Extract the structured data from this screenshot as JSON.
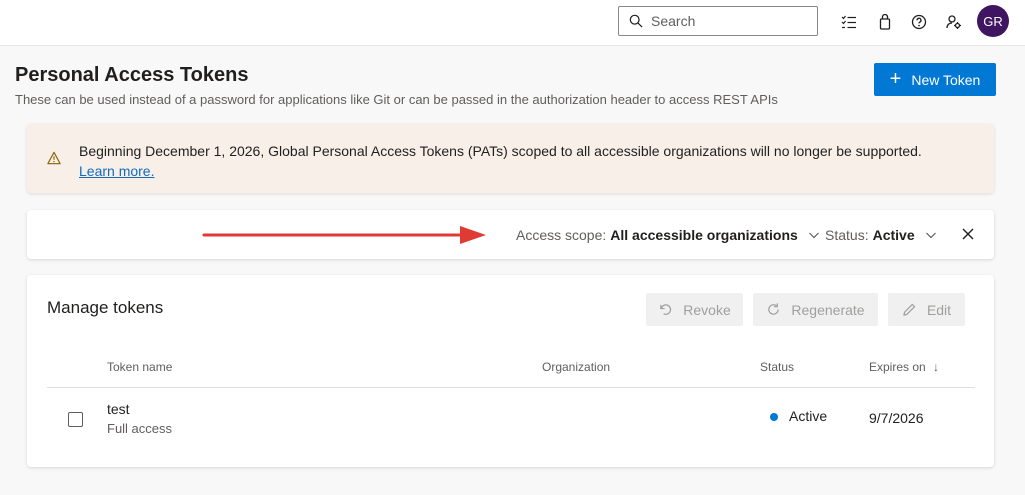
{
  "topbar": {
    "search_placeholder": "Search",
    "icons": [
      "search-icon",
      "task-list-icon",
      "shopping-bag-icon",
      "help-icon",
      "user-settings-icon"
    ],
    "avatar_initials": "GR",
    "avatar_color": "#3f1460"
  },
  "header": {
    "title": "Personal Access Tokens",
    "subtitle": "These can be used instead of a password for applications like Git or can be passed in the authorization header to access REST APIs",
    "new_token_label": "New Token"
  },
  "banner": {
    "message": "Beginning December 1, 2026, Global Personal Access Tokens (PATs) scoped to all accessible organizations will no longer be supported.",
    "link_text": "Learn more.",
    "background": "#f8efe9",
    "icon_color": "#8a6200"
  },
  "filters": {
    "access_scope_label": "Access scope:",
    "access_scope_value": "All accessible organizations",
    "status_label": "Status:",
    "status_value": "Active"
  },
  "tokens": {
    "title": "Manage tokens",
    "actions": {
      "revoke": "Revoke",
      "regenerate": "Regenerate",
      "edit": "Edit"
    },
    "columns": {
      "name": "Token name",
      "organization": "Organization",
      "status": "Status",
      "expires": "Expires on"
    },
    "rows": [
      {
        "name": "test",
        "scope": "Full access",
        "organization": "",
        "status": "Active",
        "expires": "9/7/2026"
      }
    ]
  },
  "colors": {
    "accent": "#0078d4",
    "annotation_arrow": "#e03a35"
  }
}
